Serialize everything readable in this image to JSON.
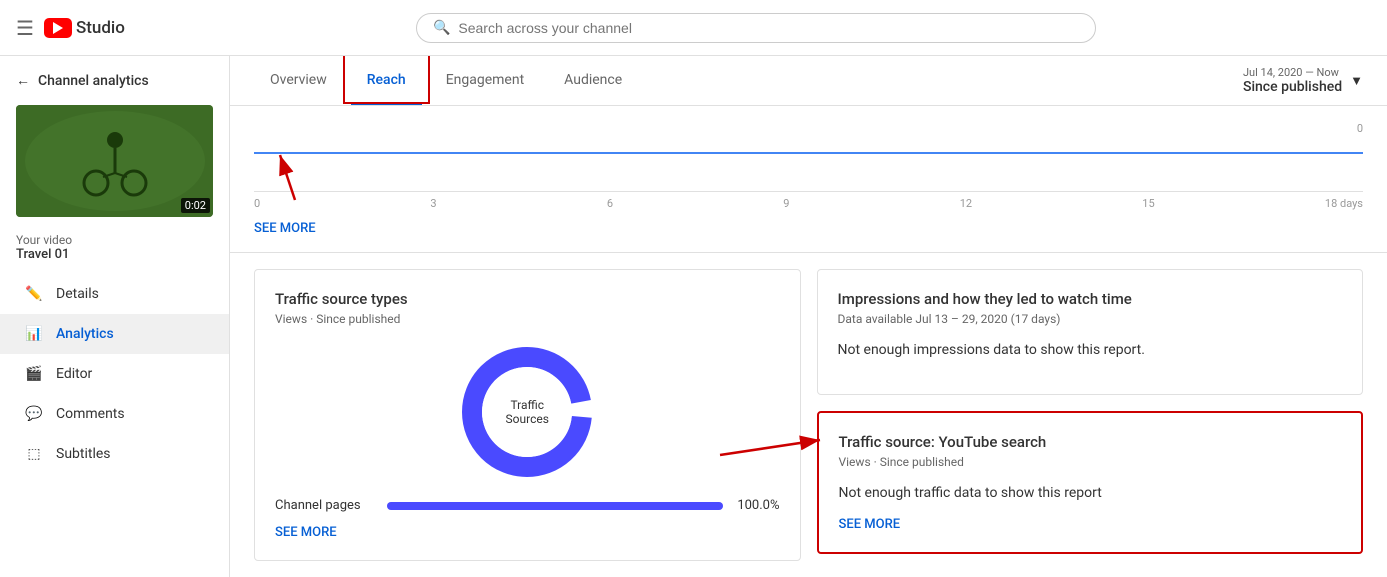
{
  "header": {
    "menu_icon": "☰",
    "logo_text": "Studio",
    "search_placeholder": "Search across your channel"
  },
  "sidebar": {
    "back_label": "Channel analytics",
    "video_label": "Your video",
    "video_name": "Travel 01",
    "video_duration": "0:02",
    "nav_items": [
      {
        "id": "details",
        "label": "Details",
        "icon": "pencil"
      },
      {
        "id": "analytics",
        "label": "Analytics",
        "icon": "analytics",
        "active": true
      },
      {
        "id": "editor",
        "label": "Editor",
        "icon": "film"
      },
      {
        "id": "comments",
        "label": "Comments",
        "icon": "comment"
      },
      {
        "id": "subtitles",
        "label": "Subtitles",
        "icon": "subtitle"
      }
    ]
  },
  "tabs": {
    "items": [
      {
        "id": "overview",
        "label": "Overview",
        "active": false
      },
      {
        "id": "reach",
        "label": "Reach",
        "active": true
      },
      {
        "id": "engagement",
        "label": "Engagement",
        "active": false
      },
      {
        "id": "audience",
        "label": "Audience",
        "active": false
      }
    ]
  },
  "date_range": {
    "range_text": "Jul 14, 2020 — Now",
    "period_text": "Since published"
  },
  "chart": {
    "x_labels": [
      "0",
      "3",
      "6",
      "9",
      "12",
      "15",
      "18 days"
    ],
    "y_label_right": "0",
    "see_more_label": "SEE MORE"
  },
  "traffic_source_card": {
    "title": "Traffic source types",
    "subtitle": "Views · Since published",
    "donut_center_line1": "Traffic",
    "donut_center_line2": "Sources",
    "progress_rows": [
      {
        "label": "Channel pages",
        "pct": 100.0,
        "pct_text": "100.0%"
      }
    ],
    "see_more_label": "SEE MORE"
  },
  "impressions_card": {
    "title": "Impressions and how they led to watch time",
    "subtitle": "Data available Jul 13 – 29, 2020 (17 days)",
    "no_data_text": "Not enough impressions data to show this report."
  },
  "traffic_yt_search_card": {
    "title": "Traffic source: YouTube search",
    "subtitle": "Views · Since published",
    "no_data_text": "Not enough traffic data to show this report",
    "see_more_label": "SEE MORE"
  }
}
